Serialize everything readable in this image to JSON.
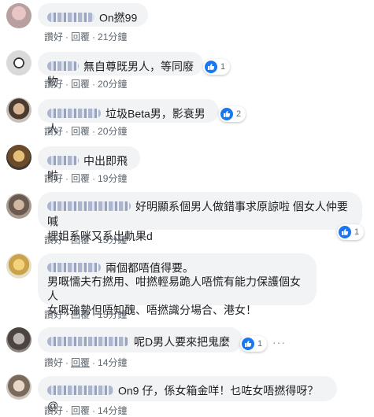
{
  "actions": {
    "like": "讚好",
    "reply": "回覆",
    "separator": "·"
  },
  "comments": [
    {
      "text": "On撚99",
      "time": "21分鐘",
      "reaction": ""
    },
    {
      "text": "無自尊既男人，等同廢物",
      "time": "20分鐘",
      "reaction": "1"
    },
    {
      "text": "垃圾Beta男，影衰男人",
      "time": "20分鐘",
      "reaction": "2"
    },
    {
      "text": "中出即飛啦",
      "time": "19分鐘",
      "reaction": ""
    },
    {
      "text_line1": "好明顯系個男人做錯事求原諒啦 個女人仲要喊",
      "text_line2": "埋姐系咪又系出軌果d",
      "time": "15分鐘",
      "reaction": "1"
    },
    {
      "text_line1": "兩個都唔值得要。",
      "text_line2": "男嘅懦夫冇撚用、咁撚輕易跪人唔慌有能力保護個女人",
      "text_line3": "女嘅強勢但唔知醜、唔撚識分場合、港女！",
      "time": "15分鐘",
      "reaction": ""
    },
    {
      "text": "呢D男人要來把鬼麼",
      "time": "14分鐘",
      "reaction": "1",
      "more": "···"
    },
    {
      "text": "On9 仔，係女箱金咩！乜咗女唔撚得呀？@",
      "time": "14分鐘",
      "reaction": ""
    }
  ],
  "colors": {
    "like_blue": "#1877f2",
    "bubble_bg": "#f2f3f5",
    "meta_grey": "#606770"
  }
}
